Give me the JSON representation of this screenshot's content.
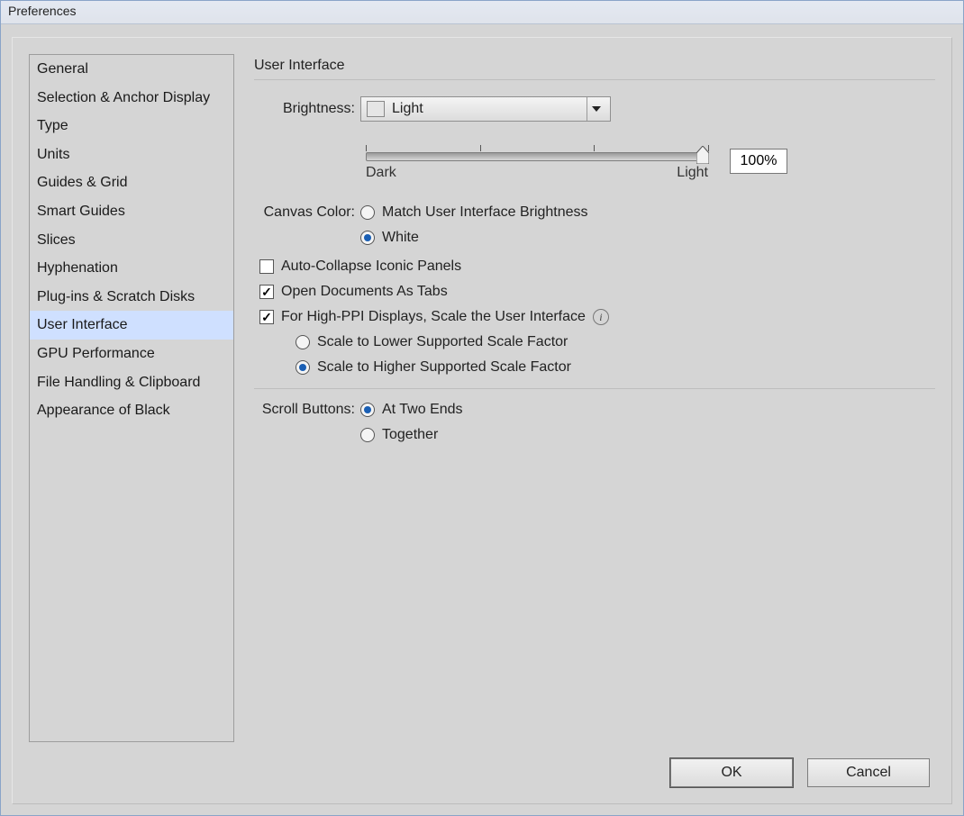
{
  "window": {
    "title": "Preferences"
  },
  "sidebar": {
    "items": [
      "General",
      "Selection & Anchor Display",
      "Type",
      "Units",
      "Guides & Grid",
      "Smart Guides",
      "Slices",
      "Hyphenation",
      "Plug-ins & Scratch Disks",
      "User Interface",
      "GPU Performance",
      "File Handling & Clipboard",
      "Appearance of Black"
    ],
    "selected_index": 9
  },
  "panel": {
    "heading": "User Interface",
    "brightness": {
      "label": "Brightness:",
      "value_text": "Light",
      "left_label": "Dark",
      "right_label": "Light",
      "percent": "100%"
    },
    "canvas_color": {
      "label": "Canvas Color:",
      "options": [
        {
          "text": "Match User Interface Brightness",
          "selected": false
        },
        {
          "text": "White",
          "selected": true
        }
      ]
    },
    "auto_collapse": {
      "text": "Auto-Collapse Iconic Panels",
      "checked": false
    },
    "open_tabs": {
      "text": "Open Documents As Tabs",
      "checked": true
    },
    "high_ppi": {
      "text": "For High-PPI Displays, Scale the User Interface",
      "checked": true,
      "options": [
        {
          "text": "Scale to Lower Supported Scale Factor",
          "selected": false
        },
        {
          "text": "Scale to Higher Supported Scale Factor",
          "selected": true
        }
      ]
    },
    "scroll": {
      "label": "Scroll Buttons:",
      "options": [
        {
          "text": "At Two Ends",
          "selected": true
        },
        {
          "text": "Together",
          "selected": false
        }
      ]
    }
  },
  "buttons": {
    "ok": "OK",
    "cancel": "Cancel"
  }
}
